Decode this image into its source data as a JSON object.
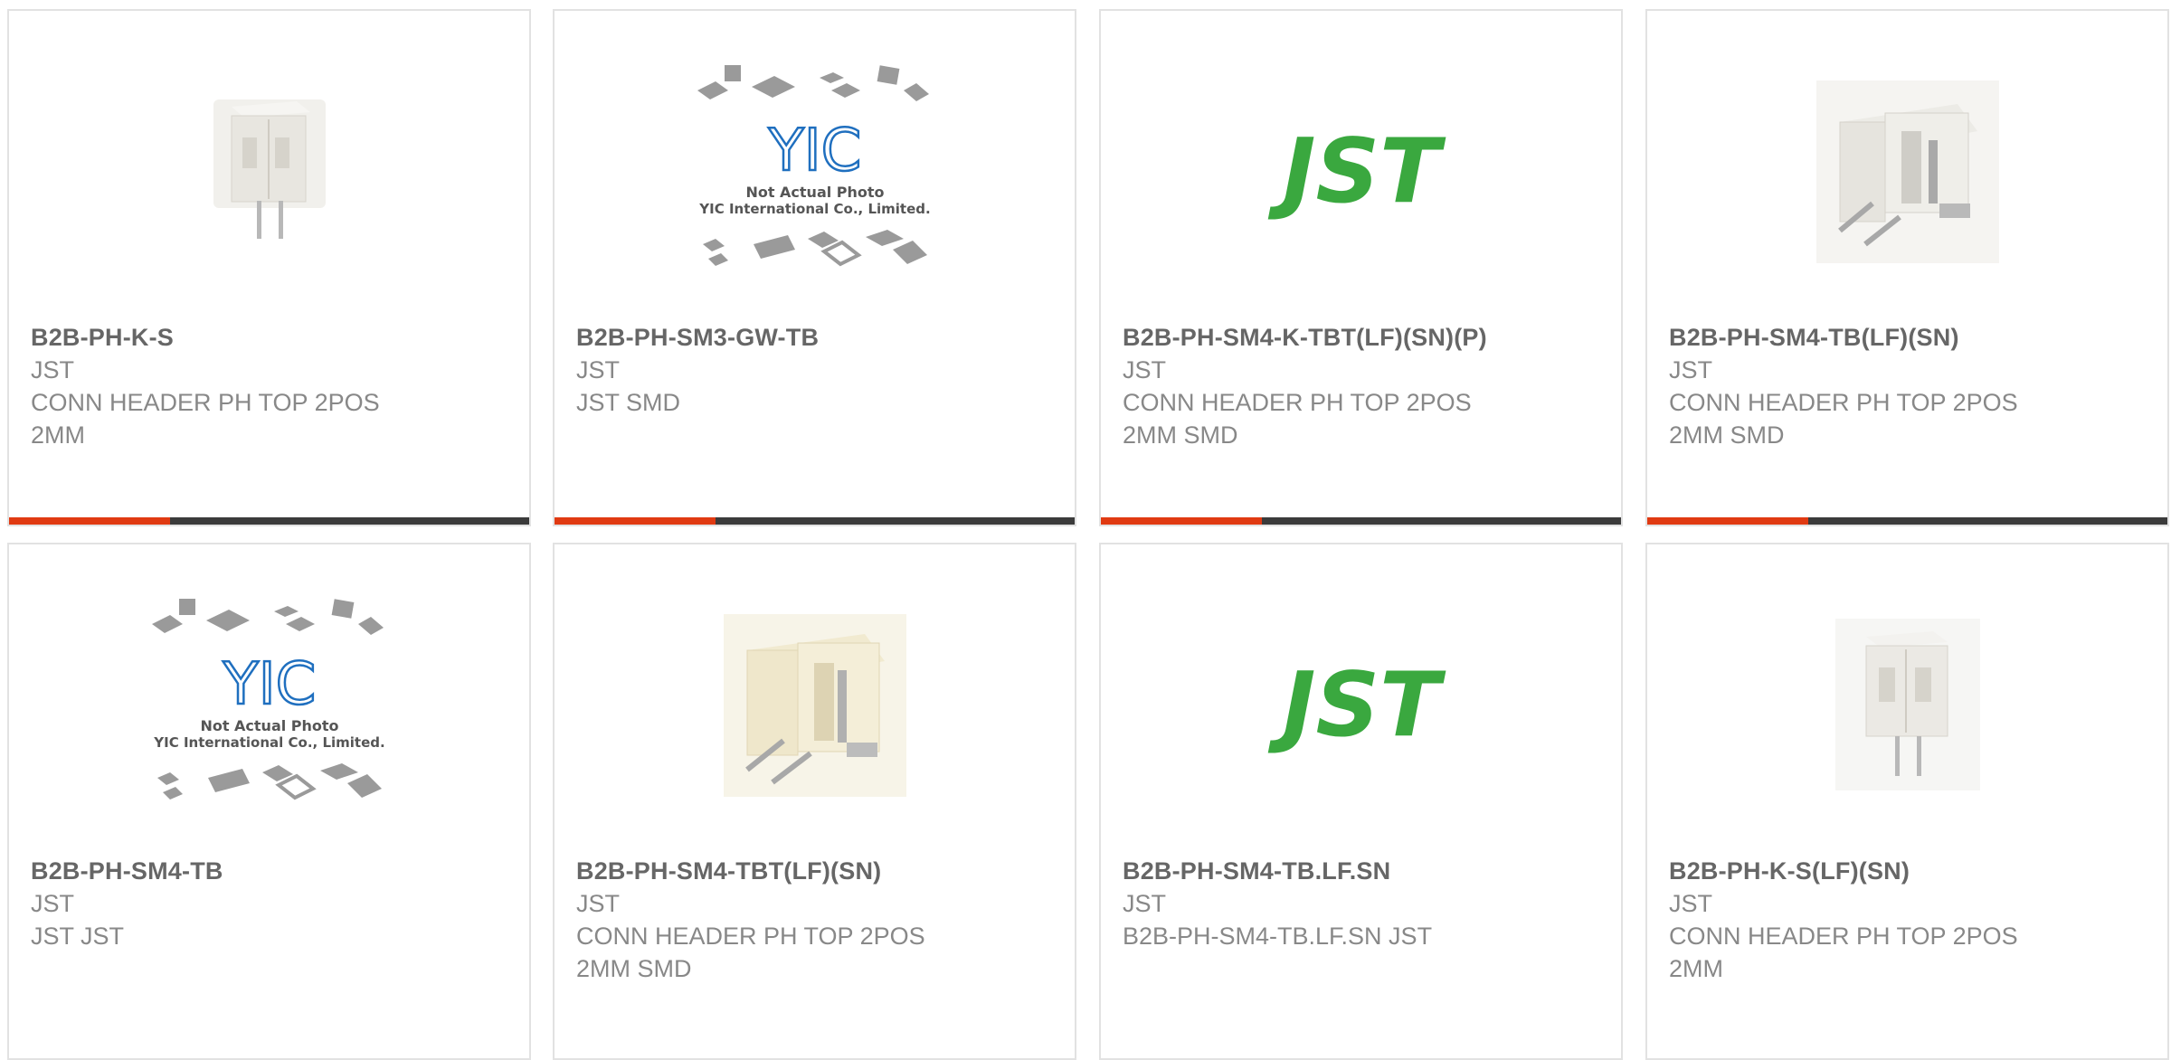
{
  "colors": {
    "accent": "#e03a12",
    "bar": "#3b3b3b",
    "jst_green": "#3aa83f",
    "yic_blue": "#1f6fbf"
  },
  "placeholder": {
    "line1": "Not Actual Photo",
    "line2": "YIC International Co., Limited.",
    "logo": "YIC"
  },
  "products": [
    {
      "part": "B2B-PH-K-S",
      "mfr": "JST",
      "desc1": "CONN HEADER PH TOP 2POS",
      "desc2": "2MM",
      "image": "vertical-connector-photo",
      "progress": 0.31
    },
    {
      "part": "B2B-PH-SM3-GW-TB",
      "mfr": "JST",
      "desc1": "JST SMD",
      "desc2": "",
      "image": "yic-placeholder",
      "progress": 0.31
    },
    {
      "part": "B2B-PH-SM4-K-TBT(LF)(SN)(P)",
      "mfr": "JST",
      "desc1": "CONN HEADER PH TOP 2POS",
      "desc2": "2MM SMD",
      "image": "jst-logo",
      "logo_text": "JST",
      "progress": 0.31
    },
    {
      "part": "B2B-PH-SM4-TB(LF)(SN)",
      "mfr": "JST",
      "desc1": "CONN HEADER PH TOP 2POS",
      "desc2": "2MM SMD",
      "image": "smd-connector-photo",
      "progress": 0.31
    },
    {
      "part": "B2B-PH-SM4-TB",
      "mfr": "JST",
      "desc1": "JST JST",
      "desc2": "",
      "image": "yic-placeholder"
    },
    {
      "part": "B2B-PH-SM4-TBT(LF)(SN)",
      "mfr": "JST",
      "desc1": "CONN HEADER PH TOP 2POS",
      "desc2": "2MM SMD",
      "image": "smd-connector-photo"
    },
    {
      "part": "B2B-PH-SM4-TB.LF.SN",
      "mfr": "JST",
      "desc1": "B2B-PH-SM4-TB.LF.SN JST",
      "desc2": "",
      "image": "jst-logo",
      "logo_text": "JST"
    },
    {
      "part": "B2B-PH-K-S(LF)(SN)",
      "mfr": "JST",
      "desc1": "CONN HEADER PH TOP 2POS",
      "desc2": "2MM",
      "image": "vertical-connector-photo"
    }
  ]
}
